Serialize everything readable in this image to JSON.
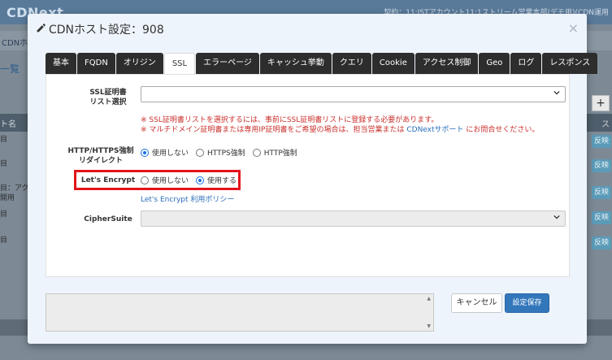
{
  "background": {
    "logo": "CDNext",
    "account_text": "契約：11:JSTアカウント11:1ストリーム営業本部(デモ用)(CDN運用",
    "tab_text": "CDNホ",
    "heading": "一覧",
    "table_header_name": "ト名",
    "table_header_status": "ス",
    "rows": [
      {
        "text": "目"
      },
      {
        "text": "目"
      },
      {
        "text": "目：アク"
      },
      {
        "text": "開用"
      },
      {
        "text": "目"
      },
      {
        "text": "目"
      }
    ],
    "row_button_label": "反映",
    "plus_label": "+"
  },
  "modal": {
    "title": "CDNホスト設定：908",
    "tabs": [
      {
        "label": "基本"
      },
      {
        "label": "FQDN"
      },
      {
        "label": "オリジン"
      },
      {
        "label": "SSL",
        "active": true
      },
      {
        "label": "エラーページ"
      },
      {
        "label": "キャッシュ挙動"
      },
      {
        "label": "クエリ"
      },
      {
        "label": "Cookie"
      },
      {
        "label": "アクセス制御"
      },
      {
        "label": "Geo"
      },
      {
        "label": "ログ"
      },
      {
        "label": "レスポンス"
      }
    ],
    "ssl_cert": {
      "label_line1": "SSL証明書",
      "label_line2": "リスト選択",
      "value": "",
      "note1": "※ SSL証明書リストを選択するには、事前にSSL証明書リストに登録する必要があります。",
      "note2_prefix": "※ マルチドメイン証明書または専用IP証明書をご希望の場合は、担当営業または ",
      "note2_link": "CDNextサポート",
      "note2_suffix": " にお問合せください。"
    },
    "redirect": {
      "label_line1": "HTTP/HTTPS強制",
      "label_line2": "リダイレクト",
      "options": [
        "使用しない",
        "HTTPS強制",
        "HTTP強制"
      ],
      "selected": 0
    },
    "lets_encrypt": {
      "label": "Let's Encrypt",
      "options": [
        "使用しない",
        "使用する"
      ],
      "selected": 1,
      "policy_link": "Let's Encrypt 利用ポリシー"
    },
    "cipher_suite": {
      "label": "CipherSuite",
      "value": ""
    },
    "footer": {
      "textarea_value": "",
      "cancel_label": "キャンセル",
      "save_label": "設定保存"
    }
  },
  "colors": {
    "accent": "#3377bb",
    "highlight": "#e3141b",
    "note_red": "#c9302c",
    "link_blue": "#2a6ebb",
    "tab_dark": "#2d2d2d"
  }
}
